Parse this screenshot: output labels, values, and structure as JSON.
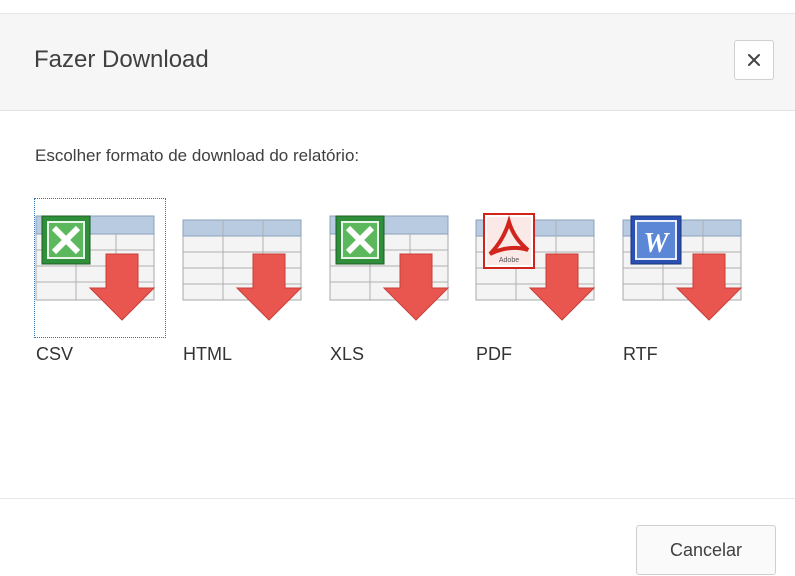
{
  "dialog": {
    "title": "Fazer Download",
    "close_glyph": "×",
    "instruction": "Escolher formato de download do relatório:",
    "cancel_label": "Cancelar"
  },
  "formats": [
    {
      "label": "CSV",
      "icon": "csv-icon",
      "badge": "excel-x",
      "focused": true
    },
    {
      "label": "HTML",
      "icon": "html-icon",
      "badge": "none"
    },
    {
      "label": "XLS",
      "icon": "xls-icon",
      "badge": "excel-x"
    },
    {
      "label": "PDF",
      "icon": "pdf-icon",
      "badge": "adobe-pdf",
      "badge_text": "Adobe"
    },
    {
      "label": "RTF",
      "icon": "rtf-icon",
      "badge": "word-w",
      "badge_text": "W"
    }
  ],
  "colors": {
    "arrow": "#e8564f",
    "excel_green": "#2f8f3a",
    "word_blue": "#2b4fb3",
    "pdf_red": "#d0241c",
    "focus_ring": "#3572b0"
  }
}
